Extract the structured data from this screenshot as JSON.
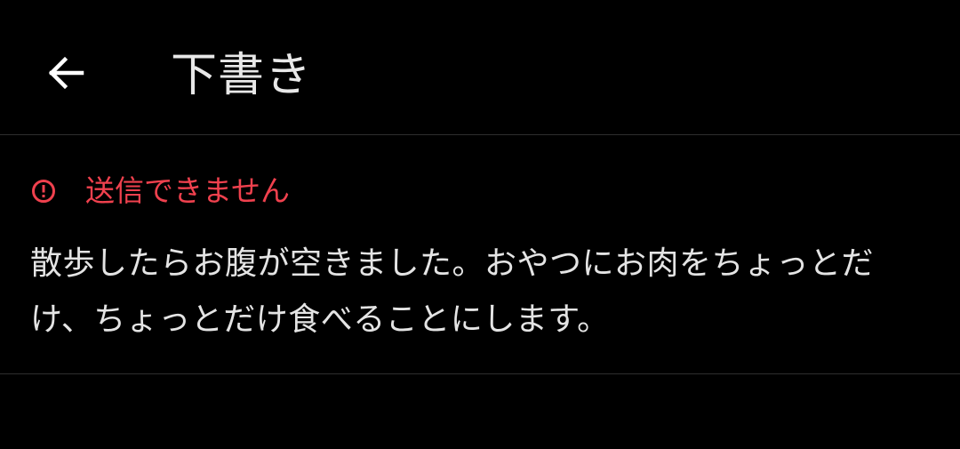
{
  "header": {
    "title": "下書き",
    "back_icon": "arrow-left-icon"
  },
  "draft": {
    "status_icon": "alert-circle-icon",
    "status_text": "送信できません",
    "message": "散歩したらお腹が空きました。おやつにお肉をちょっとだけ、ちょっとだけ食べることにします。"
  },
  "colors": {
    "background": "#000000",
    "error": "#f0414e",
    "text": "#e4e4e4",
    "divider": "#2e2e2e"
  }
}
